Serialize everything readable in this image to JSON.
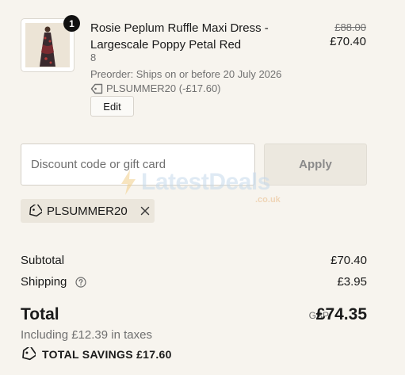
{
  "product": {
    "quantity": "1",
    "name": "Rosie Peplum Ruffle Maxi Dress - Largescale Poppy Petal Red",
    "variant": "8",
    "preorder_note": "Preorder: Ships on or before 20 July 2026",
    "discount_line": "PLSUMMER20 (-£17.60)",
    "original_price": "£88.00",
    "price": "£70.40",
    "edit_label": "Edit",
    "image_icon": "dress-thumbnail"
  },
  "discount": {
    "placeholder": "Discount code or gift card",
    "apply_label": "Apply",
    "applied_code": "PLSUMMER20"
  },
  "watermark": {
    "brand": "LatestDeals",
    "domain": ".co.uk"
  },
  "summary": {
    "subtotal_label": "Subtotal",
    "subtotal_value": "£70.40",
    "shipping_label": "Shipping",
    "shipping_value": "£3.95",
    "total_label": "Total",
    "currency": "GBP",
    "total_value": "£74.35",
    "taxes_note": "Including £12.39 in taxes",
    "savings_label": "TOTAL SAVINGS £17.60"
  },
  "colors": {
    "background": "#f7f4ee",
    "chip_background": "#ebe6dc",
    "badge": "#111111",
    "muted_text": "#707070"
  }
}
